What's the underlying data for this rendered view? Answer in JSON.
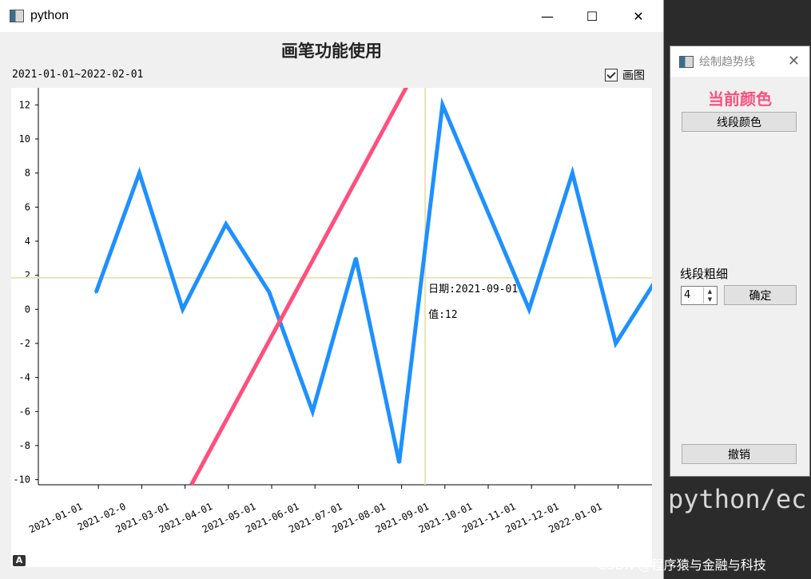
{
  "main_window": {
    "title": "python",
    "minimize": "—",
    "maximize": "☐",
    "close": "✕"
  },
  "chart_header": {
    "title": "画笔功能使用",
    "date_range": "2021-01-01~2022-02-01",
    "draw_checkbox_label": "画图",
    "draw_checked": true
  },
  "tooltip": {
    "date": "日期:2021-09-01",
    "value": "值:12"
  },
  "chart_data": {
    "type": "line",
    "x": [
      "2021-01-01",
      "2021-02-0",
      "2021-03-01",
      "2021-04-01",
      "2021-05-01",
      "2021-06-01",
      "2021-07-01",
      "2021-08-01",
      "2021-09-01",
      "2021-10-01",
      "2021-11-01",
      "2021-12-01",
      "2022-01-01"
    ],
    "series": [
      {
        "values": [
          1,
          8,
          0,
          5,
          1,
          -6,
          3,
          -9,
          12,
          6,
          0,
          8,
          -2,
          2
        ],
        "color": "#1e90ff"
      }
    ],
    "trend_line": {
      "from": [
        3.2,
        -10.3
      ],
      "to": [
        8.2,
        13.2
      ],
      "color": "#ff4f7d"
    },
    "crosshair": {
      "x": 8.6,
      "y": 1.85,
      "color": "#e8e4b4"
    },
    "yticks": [
      "12",
      "10",
      "8",
      "6",
      "4",
      "2",
      "0",
      "-2",
      "-4",
      "-6",
      "-8",
      "-10"
    ],
    "ylim": [
      -10.3,
      13.0
    ],
    "xlabel": "",
    "ylabel": "",
    "grid": false
  },
  "dialog": {
    "title": "绘制趋势线",
    "close": "✕",
    "current_color_label": "当前颜色",
    "current_color": "#ff4f7d",
    "segment_color_button": "线段颜色",
    "thickness_label": "线段粗细",
    "thickness_value": "4",
    "confirm_button": "确定",
    "undo_button": "撤销"
  },
  "background": {
    "code_text": "python/ec",
    "watermark": "CSDN @程序猿与金融与科技"
  },
  "corner_badge": "A"
}
